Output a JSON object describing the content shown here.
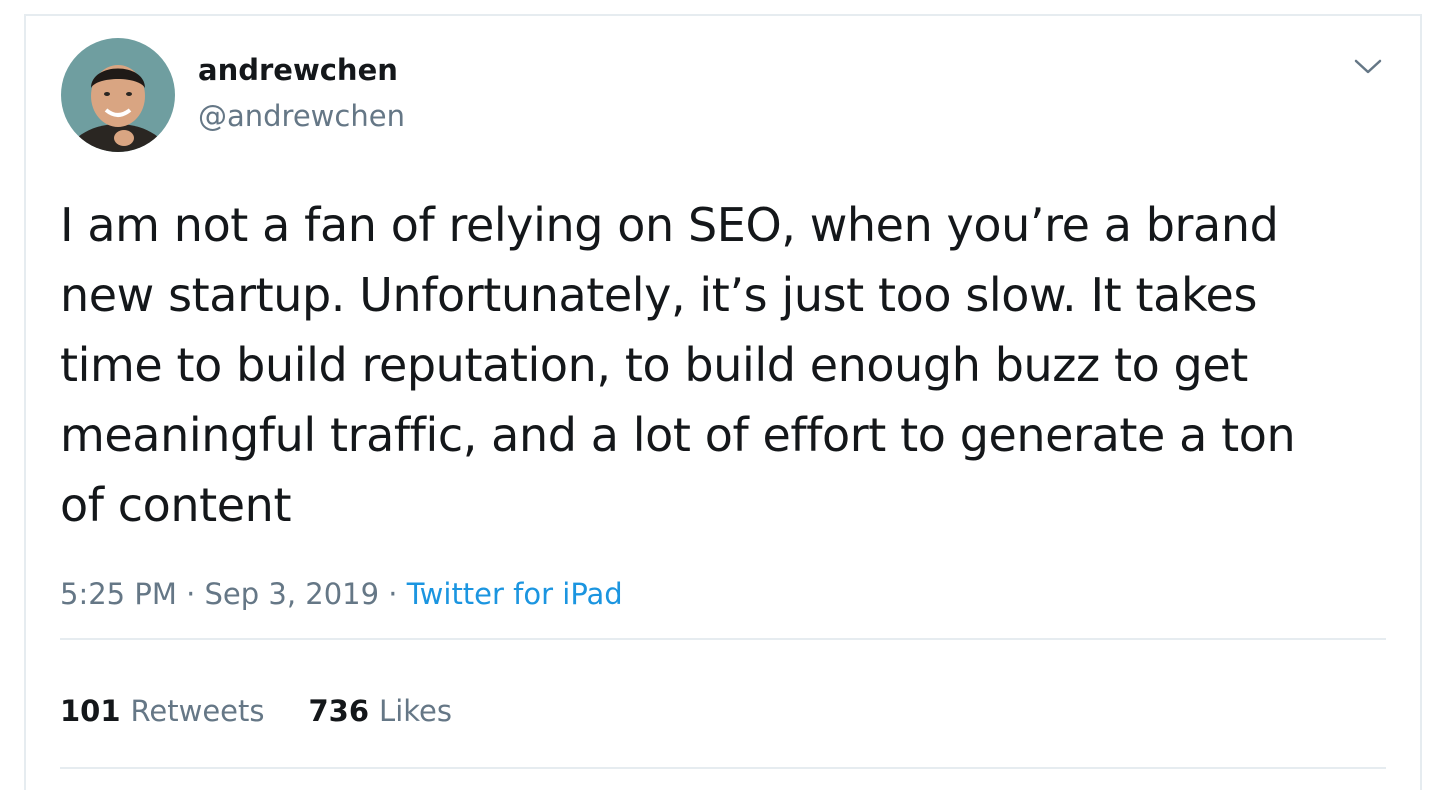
{
  "author": {
    "display_name": "andrewchen",
    "handle": "@andrewchen"
  },
  "tweet": {
    "lines": [
      "I am not a fan of relying on SEO, when you’re a brand",
      "new startup. Unfortunately, it’s just too slow. It takes",
      "time to build reputation, to build enough buzz to get",
      "meaningful traffic, and a lot of effort to generate a ton",
      "of content"
    ]
  },
  "meta": {
    "time": "5:25 PM",
    "separator": " · ",
    "date": "Sep 3, 2019",
    "source": "Twitter for iPad"
  },
  "stats": {
    "retweets_count": "101",
    "retweets_label": "Retweets",
    "likes_count": "736",
    "likes_label": "Likes"
  },
  "icons": {
    "caret": "chevron-down-icon",
    "avatar": "avatar"
  },
  "colors": {
    "text_primary": "#14171a",
    "text_secondary": "#657786",
    "link": "#1b95e0",
    "border": "#e6ecf0"
  }
}
